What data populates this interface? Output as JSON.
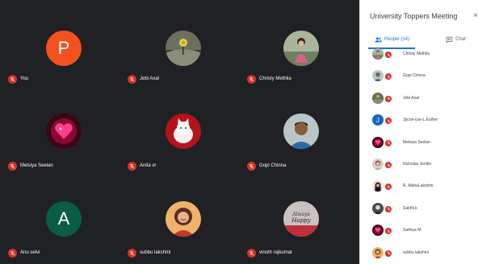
{
  "meeting": {
    "title": "University Toppers Meeting",
    "close_glyph": "×"
  },
  "tabs": {
    "people_label": "People (14)",
    "chat_label": "Chat"
  },
  "tiles": [
    {
      "name": "You",
      "avatar": "letter",
      "letter": "P",
      "color": "#f4511e"
    },
    {
      "name": "Jebi Axal",
      "avatar": "photo",
      "photo": "dandelion-photo"
    },
    {
      "name": "Christy Methila",
      "avatar": "photo",
      "photo": "girl-sitting-photo"
    },
    {
      "name": "Melsiya Seelan",
      "avatar": "photo",
      "photo": "pink-heart-photo"
    },
    {
      "name": "Anita vr",
      "avatar": "photo",
      "photo": "white-kitten-photo"
    },
    {
      "name": "Gopi Chinna",
      "avatar": "photo",
      "photo": "man-portrait-photo"
    },
    {
      "name": "Anu selvi",
      "avatar": "letter",
      "letter": "A",
      "color": "#0b5c44"
    },
    {
      "name": "subbu lakshmi",
      "avatar": "photo",
      "photo": "smiling-girl-photo"
    },
    {
      "name": "vinoth rajkumar",
      "avatar": "photo",
      "photo": "happy-text-photo"
    }
  ],
  "participants": [
    {
      "name": "Christy Methila",
      "avatar": "photo",
      "photo": "girl-sitting-photo"
    },
    {
      "name": "Gopi Chinna",
      "avatar": "photo",
      "photo": "man-portrait-photo"
    },
    {
      "name": "Jebi Axal",
      "avatar": "photo",
      "photo": "dandelion-photo"
    },
    {
      "name": "Jpcoe-cse-L.Esther",
      "avatar": "letter",
      "letter": "J",
      "color": "#1565c0"
    },
    {
      "name": "Melsiya Seelan",
      "avatar": "photo",
      "photo": "pink-heart-photo"
    },
    {
      "name": "Nicholas Jenifer",
      "avatar": "photo",
      "photo": "woman-photo"
    },
    {
      "name": "R. MahaLakshmi",
      "avatar": "photo",
      "photo": "dark-hair-photo"
    },
    {
      "name": "Sakthi.k",
      "avatar": "photo",
      "photo": "dark-portrait-photo"
    },
    {
      "name": "Sathiya M",
      "avatar": "photo",
      "photo": "pink-heart-photo"
    },
    {
      "name": "subbu lakshmi",
      "avatar": "photo",
      "photo": "smiling-girl-photo"
    }
  ],
  "colors": {
    "stage_bg": "#202124",
    "mic_off": "#d93025",
    "accent": "#1a73e8"
  }
}
